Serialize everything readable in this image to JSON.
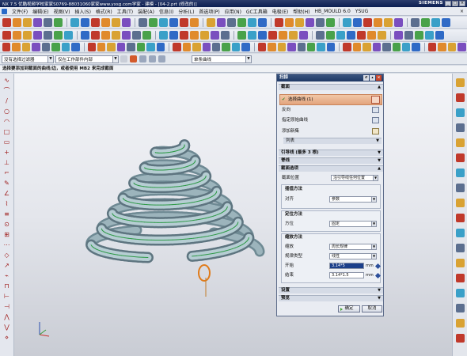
{
  "window": {
    "title": "NX 7.5 优酷视频学校家家S0769-88031060家家www.yxsg.com学家 - 建模 - [04-2.prt (修改的)]",
    "brand": "SIEMENS",
    "controls": [
      "_",
      "□",
      "×"
    ]
  },
  "menu": {
    "items": [
      "文件(F)",
      "编辑(E)",
      "视图(V)",
      "插入(S)",
      "格式(R)",
      "工具(T)",
      "装配(A)",
      "信息(I)",
      "分析(L)",
      "首选项(P)",
      "应用(N)",
      "GC工具箱",
      "电极(E)",
      "帮助(H)",
      "HB_MOULD 6.0",
      "YSUG"
    ],
    "close_glyph": "×"
  },
  "selection_bar": {
    "filter": "没有选择过滤器",
    "scope": "仅在工作部件内部",
    "snap": "单条曲线"
  },
  "status": {
    "prompt": "选择要添加到截面的曲线/边，或者使用 MB2 来完成截面"
  },
  "dialog": {
    "title": "扫掠",
    "sections": {
      "section": "截面",
      "select_curve": "选择曲线 (1)",
      "reverse": "反向",
      "specify_origin": "指定原始曲线",
      "add_new": "添加新集",
      "list": "列表",
      "guide": "引导线 (最多 3 根)",
      "spine": "脊线",
      "section_options": "截面选项",
      "section_location": "截面位置",
      "section_location_value": "沿引导线任何位置",
      "interp_header": "插值方法",
      "alignment_label": "对齐",
      "alignment_value": "参数",
      "orient_header": "定位方法",
      "orientation_label": "方位",
      "orientation_value": "固定",
      "scale_header": "缩放方法",
      "scale_label": "缩放",
      "scale_value": "周长规律",
      "law_type_label": "规律类型",
      "law_type_value": "线性",
      "start_label": "开始",
      "start_value": "3.14*5",
      "end_label": "结束",
      "end_value": "3.14*1.5",
      "unit": "mm",
      "settings": "设置",
      "preview": "预览"
    },
    "ok": "确定",
    "cancel": "取消"
  },
  "icons": {
    "toolbar_colors": [
      "#2f6ac6",
      "#d9a233",
      "#49a24a",
      "#c0392b",
      "#7a4fbf",
      "#3aa0c8",
      "#e08a2c",
      "#5c6f8f"
    ],
    "accent": "#1e3865",
    "highlight": "#e3a47d"
  }
}
